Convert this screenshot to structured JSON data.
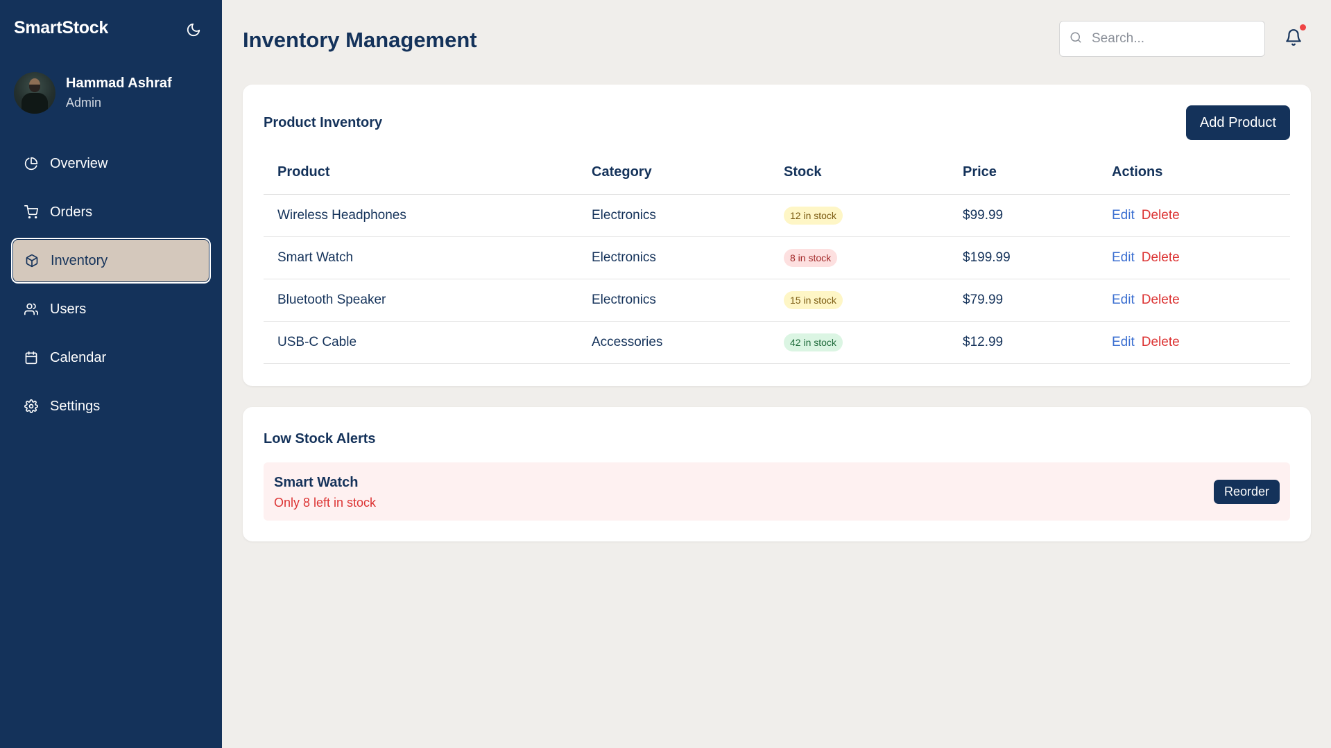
{
  "app": {
    "brand": "SmartStock",
    "theme_icon": "moon-icon"
  },
  "user": {
    "name": "Hammad Ashraf",
    "role": "Admin"
  },
  "sidebar": {
    "items": [
      {
        "label": "Overview",
        "icon": "pie-chart-icon",
        "active": false
      },
      {
        "label": "Orders",
        "icon": "cart-icon",
        "active": false
      },
      {
        "label": "Inventory",
        "icon": "box-icon",
        "active": true
      },
      {
        "label": "Users",
        "icon": "users-icon",
        "active": false
      },
      {
        "label": "Calendar",
        "icon": "calendar-icon",
        "active": false
      },
      {
        "label": "Settings",
        "icon": "gear-icon",
        "active": false
      }
    ]
  },
  "header": {
    "title": "Inventory Management",
    "search_placeholder": "Search...",
    "has_notification": true
  },
  "inventory": {
    "title": "Product Inventory",
    "add_button": "Add Product",
    "columns": [
      "Product",
      "Category",
      "Stock",
      "Price",
      "Actions"
    ],
    "rows": [
      {
        "product": "Wireless Headphones",
        "category": "Electronics",
        "stock": "12 in stock",
        "stock_level": "yellow",
        "price": "$99.99",
        "edit": "Edit",
        "delete": "Delete"
      },
      {
        "product": "Smart Watch",
        "category": "Electronics",
        "stock": "8 in stock",
        "stock_level": "red",
        "price": "$199.99",
        "edit": "Edit",
        "delete": "Delete"
      },
      {
        "product": "Bluetooth Speaker",
        "category": "Electronics",
        "stock": "15 in stock",
        "stock_level": "yellow",
        "price": "$79.99",
        "edit": "Edit",
        "delete": "Delete"
      },
      {
        "product": "USB-C Cable",
        "category": "Accessories",
        "stock": "42 in stock",
        "stock_level": "green",
        "price": "$12.99",
        "edit": "Edit",
        "delete": "Delete"
      }
    ]
  },
  "alerts": {
    "title": "Low Stock Alerts",
    "items": [
      {
        "name": "Smart Watch",
        "message": "Only 8 left in stock",
        "action": "Reorder"
      }
    ]
  },
  "colors": {
    "primary": "#14325a",
    "background": "#f0eeeb",
    "active_nav": "#d4c8bc",
    "danger": "#dc3333",
    "link": "#3b6fd1"
  }
}
